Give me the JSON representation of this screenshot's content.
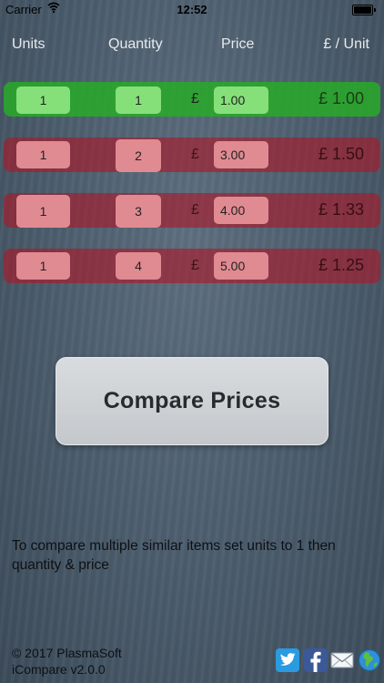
{
  "status_bar": {
    "carrier": "Carrier",
    "time": "12:52",
    "battery_level": 1.0
  },
  "columns": {
    "units": "Units",
    "quantity": "Quantity",
    "price": "Price",
    "per_unit": "£ / Unit"
  },
  "currency_symbol": "£",
  "rows": [
    {
      "units": "1",
      "quantity": "1",
      "price": "1.00",
      "per_unit": "£ 1.00",
      "status": "best"
    },
    {
      "units": "1",
      "quantity": "2",
      "price": "3.00",
      "per_unit": "£ 1.50",
      "status": "other"
    },
    {
      "units": "1",
      "quantity": "3",
      "price": "4.00",
      "per_unit": "£ 1.33",
      "status": "other"
    },
    {
      "units": "1",
      "quantity": "4",
      "price": "5.00",
      "per_unit": "£ 1.25",
      "status": "other"
    }
  ],
  "compare_button": {
    "label": "Compare Prices"
  },
  "instructions": "To compare multiple similar items set units to 1 then quantity & price",
  "footer": {
    "copyright": "© 2017 PlasmaSoft",
    "version": "iCompare v2.0.0"
  },
  "social_icons": [
    "twitter-icon",
    "facebook-icon",
    "mail-icon",
    "web-icon"
  ],
  "colors": {
    "best_row": "#28aa28",
    "other_row": "#aa1928"
  }
}
